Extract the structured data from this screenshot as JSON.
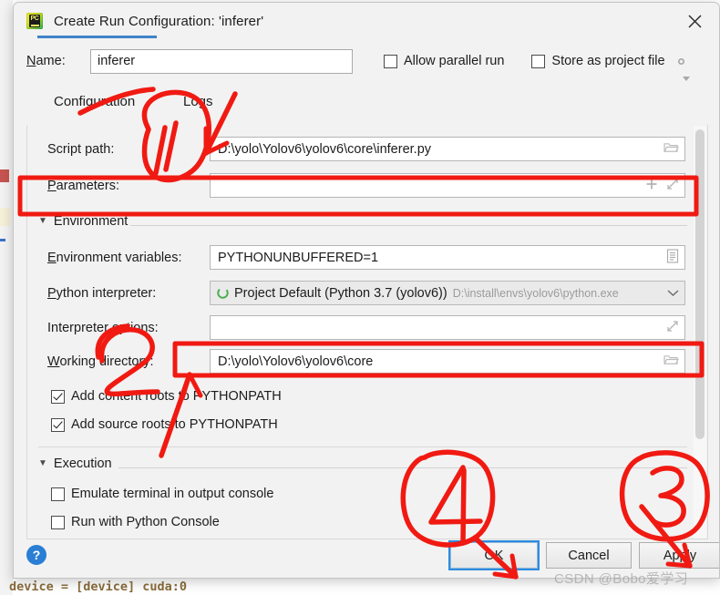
{
  "window": {
    "title": "Create Run Configuration: 'inferer'",
    "app_icon": "pycharm-icon",
    "close_icon": "close-icon"
  },
  "name_row": {
    "label": "Name:",
    "value": "inferer",
    "allow_parallel_run": {
      "label": "Allow parallel run",
      "checked": false
    },
    "store_as_project_file": {
      "label": "Store as project file",
      "checked": false
    },
    "gear_icon": "gear-icon"
  },
  "tabs": [
    {
      "label": "Configuration",
      "selected": true
    },
    {
      "label": "Logs",
      "selected": false
    }
  ],
  "form": {
    "script_path": {
      "label": "Script path:",
      "value": "D:\\yolo\\Yolov6\\yolov6\\core\\inferer.py",
      "trailing_icon": "folder-icon"
    },
    "parameters": {
      "label": "Parameters:",
      "value": "",
      "trailing_icons": [
        "plus-icon",
        "expand-icon"
      ]
    },
    "environment_section": {
      "label": "Environment",
      "expanded": true
    },
    "environment_variables": {
      "label": "Environment variables:",
      "value": "PYTHONUNBUFFERED=1",
      "trailing_icon": "list-editor-icon"
    },
    "python_interpreter": {
      "label": "Python interpreter:",
      "value": "Project Default (Python 3.7 (yolov6))",
      "sub_value": "D:\\install\\envs\\yolov6\\python.exe",
      "leading_icon": "python-env-icon",
      "trailing_icon": "chevron-down-icon"
    },
    "interpreter_options": {
      "label": "Interpreter options:",
      "value": "",
      "trailing_icon": "expand-icon"
    },
    "working_directory": {
      "label": "Working directory:",
      "value": "D:\\yolo\\Yolov6\\yolov6\\core",
      "trailing_icon": "folder-icon"
    },
    "add_content_roots": {
      "label": "Add content roots to PYTHONPATH",
      "checked": true
    },
    "add_source_roots": {
      "label": "Add source roots to PYTHONPATH",
      "checked": true
    },
    "execution_section": {
      "label": "Execution",
      "expanded": true
    },
    "emulate_terminal": {
      "label": "Emulate terminal in output console",
      "checked": false
    },
    "run_with_python_console": {
      "label": "Run with Python Console",
      "checked": false
    }
  },
  "footer": {
    "help_label": "?",
    "ok_label": "OK",
    "cancel_label": "Cancel",
    "apply_label": "Apply"
  },
  "annotations": {
    "color": "#f01a12",
    "marks": [
      {
        "name": "circled-number-1",
        "text": "1"
      },
      {
        "name": "circled-number-2",
        "text": "2"
      },
      {
        "name": "circled-number-3",
        "text": "3"
      },
      {
        "name": "circled-number-4",
        "text": "4"
      }
    ]
  },
  "watermark": {
    "text": "CSDN @Bobo爱学习"
  },
  "background_editor": {
    "code_line": "device = [device] cuda:0"
  }
}
